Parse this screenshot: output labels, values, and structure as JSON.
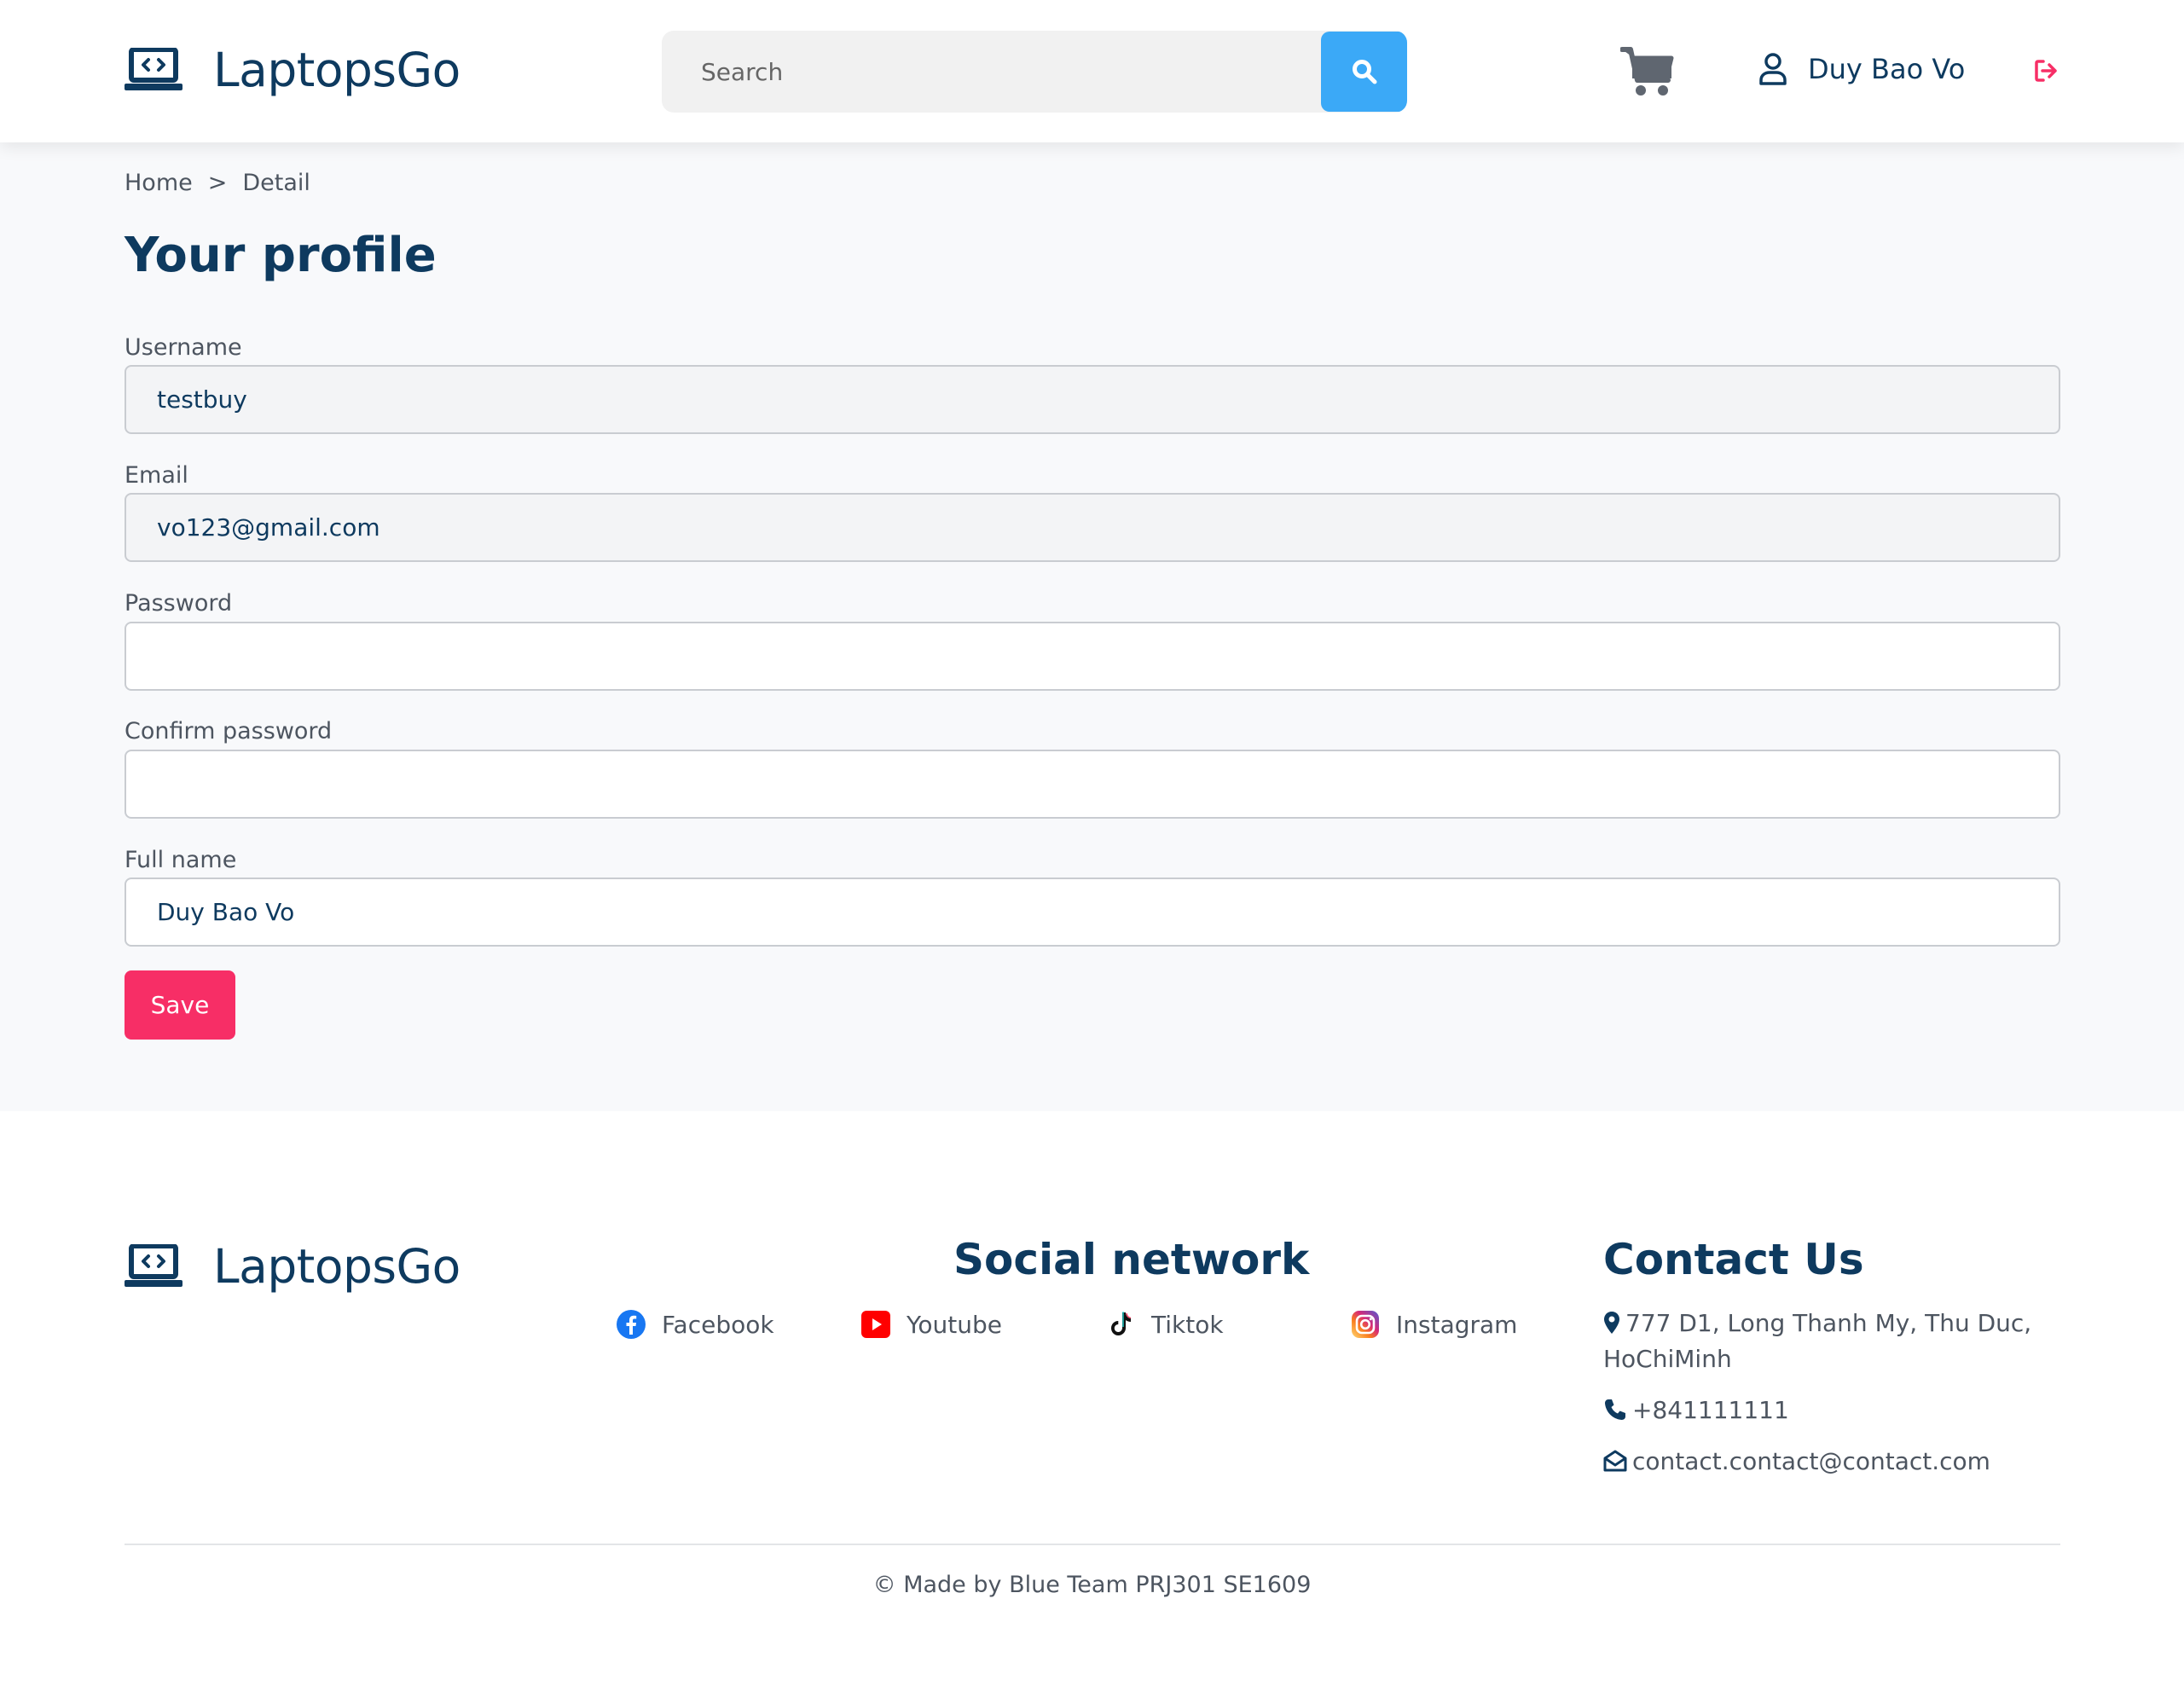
{
  "brand": {
    "name": "LaptopsGo",
    "icon": "laptop-code-icon",
    "color": "#0e3a5f"
  },
  "header": {
    "search": {
      "placeholder": "Search",
      "button_icon": "search-icon",
      "button_color": "#3ba9f7"
    },
    "cart_icon": "cart-icon",
    "user": {
      "icon": "user-icon",
      "name": "Duy Bao Vo"
    },
    "logout_icon": "logout-icon",
    "logout_color": "#f72e66"
  },
  "breadcrumb": {
    "items": [
      "Home",
      "Detail"
    ],
    "separator": ">"
  },
  "profile": {
    "title": "Your profile",
    "fields": [
      {
        "label": "Username",
        "value": "testbuy",
        "readonly": true
      },
      {
        "label": "Email",
        "value": "vo123@gmail.com",
        "readonly": true
      },
      {
        "label": "Password",
        "value": "",
        "readonly": false
      },
      {
        "label": "Confirm password",
        "value": "",
        "readonly": false
      },
      {
        "label": "Full name",
        "value": "Duy Bao Vo",
        "readonly": false
      }
    ],
    "save_label": "Save",
    "save_color": "#f72e66"
  },
  "footer": {
    "social": {
      "title": "Social network",
      "items": [
        {
          "label": "Facebook",
          "icon": "facebook-icon"
        },
        {
          "label": "Youtube",
          "icon": "youtube-icon"
        },
        {
          "label": "Tiktok",
          "icon": "tiktok-icon"
        },
        {
          "label": "Instagram",
          "icon": "instagram-icon"
        }
      ]
    },
    "contact": {
      "title": "Contact Us",
      "address_line1": "777 D1, Long Thanh My, Thu Duc,",
      "address_line2": "HoChiMinh",
      "phone": "+841111111",
      "email": "contact.contact@contact.com"
    },
    "copyright": "© Made by Blue Team PRJ301 SE1609"
  }
}
